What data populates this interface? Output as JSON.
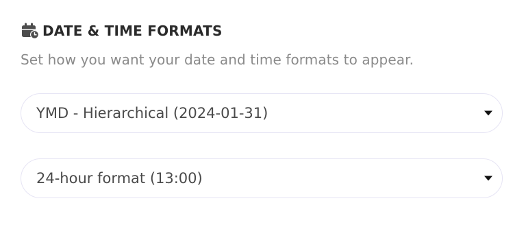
{
  "section": {
    "icon": "calendar-clock-icon",
    "title": "DATE & TIME FORMATS",
    "description": "Set how you want your date and time formats to appear."
  },
  "date_format_select": {
    "selected": "YMD - Hierarchical (2024-01-31)"
  },
  "time_format_select": {
    "selected": "24-hour format (13:00)"
  },
  "colors": {
    "title": "#2a2a2a",
    "description": "#8a8a8a",
    "select_border": "#e6e4f4",
    "select_text": "#4a4a4a",
    "icon": "#4d4d4d"
  }
}
